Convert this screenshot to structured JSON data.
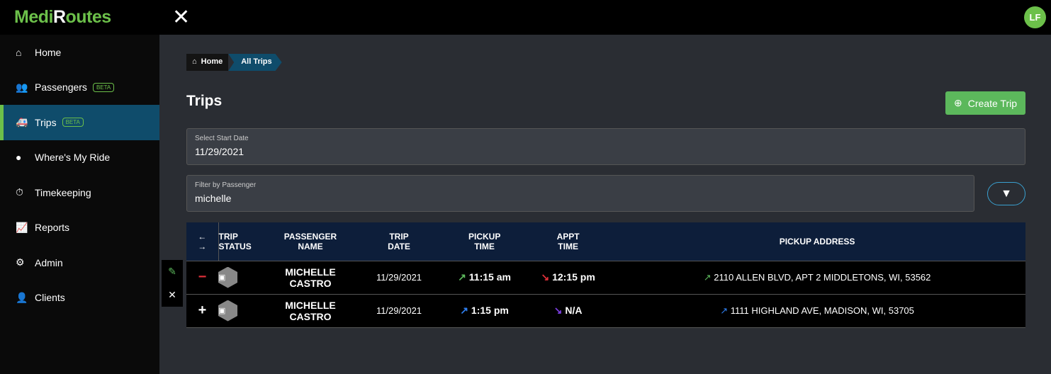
{
  "app": {
    "logo": "MediRoutes",
    "user_initials": "LF"
  },
  "sidebar": {
    "items": [
      {
        "label": "Home",
        "icon": "home-icon"
      },
      {
        "label": "Passengers",
        "icon": "users-icon",
        "badge": "BETA"
      },
      {
        "label": "Trips",
        "icon": "ambulance-icon",
        "badge": "BETA",
        "active": true
      },
      {
        "label": "Where's My Ride",
        "icon": "map-marker-icon"
      },
      {
        "label": "Timekeeping",
        "icon": "stopwatch-icon"
      },
      {
        "label": "Reports",
        "icon": "chart-icon"
      },
      {
        "label": "Admin",
        "icon": "cogs-icon"
      },
      {
        "label": "Clients",
        "icon": "user-icon"
      }
    ]
  },
  "breadcrumb": {
    "home": "Home",
    "current": "All Trips"
  },
  "page": {
    "title": "Trips",
    "create_label": "Create Trip"
  },
  "filters": {
    "start_date_label": "Select Start Date",
    "start_date": "11/29/2021",
    "passenger_label": "Filter by Passenger",
    "passenger": "michelle"
  },
  "table": {
    "headers": [
      "TRIP STATUS",
      "PASSENGER NAME",
      "TRIP DATE",
      "PICKUP TIME",
      "APPT TIME",
      "PICKUP ADDRESS"
    ],
    "rows": [
      {
        "toggle": "−",
        "name": "MICHELLE CASTRO",
        "date": "11/29/2021",
        "pickup": "11:15 am",
        "appt": "12:15 pm",
        "address": "2110 ALLEN BLVD, APT 2 MIDDLETONS, WI, 53562",
        "pickup_color": "#5cb85c",
        "appt_color": "#e0303a",
        "addr_color": "#5cb85c"
      },
      {
        "toggle": "+",
        "name": "MICHELLE CASTRO",
        "date": "11/29/2021",
        "pickup": "1:15 pm",
        "appt": "N/A",
        "address": "1111 HIGHLAND AVE, MADISON, WI, 53705",
        "pickup_color": "#2f7ff0",
        "appt_color": "#7b3fe0",
        "addr_color": "#2f7ff0"
      }
    ]
  }
}
